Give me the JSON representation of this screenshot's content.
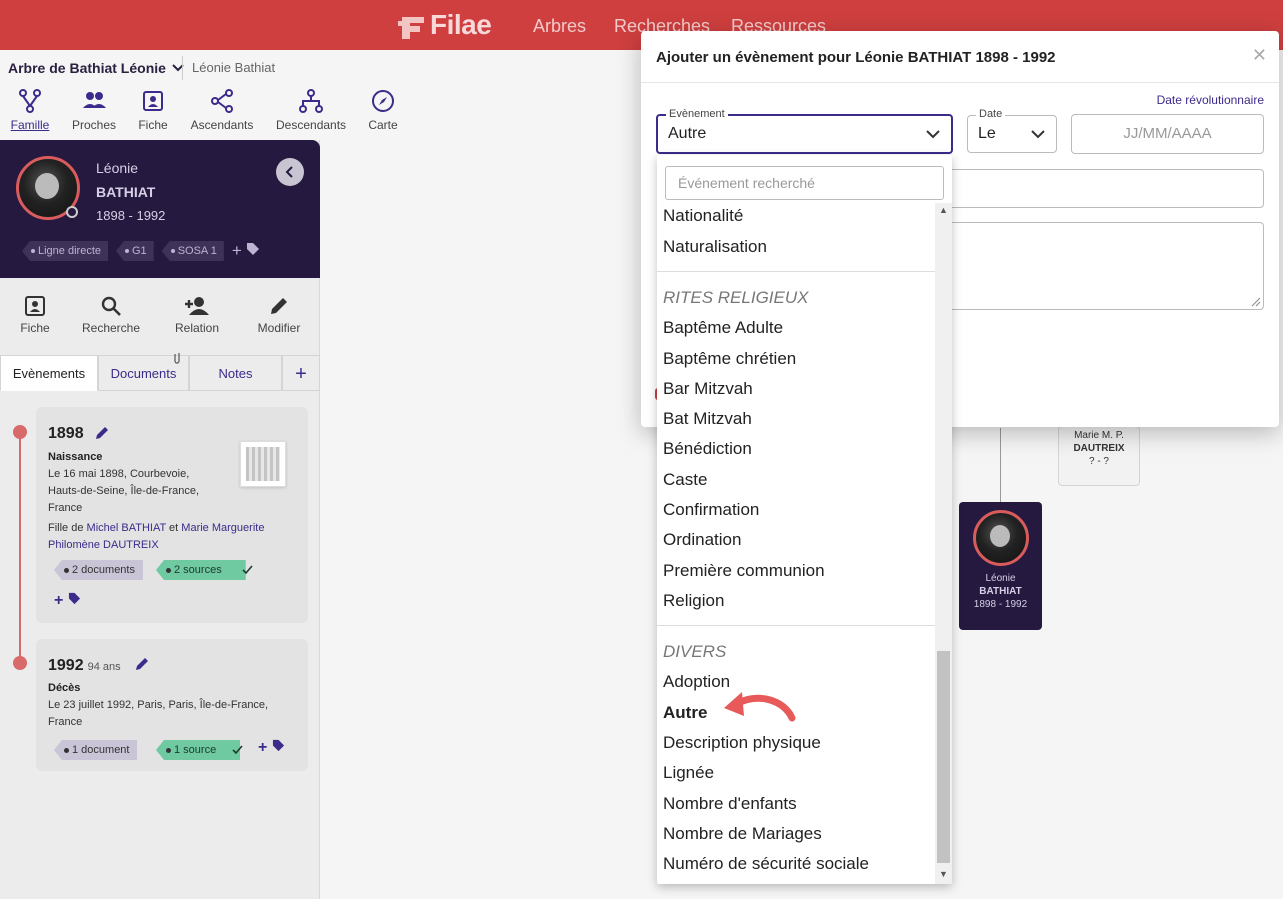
{
  "brand": {
    "name": "Filae",
    "color": "#cf3f3f",
    "accent": "#3d2a8a",
    "panel_dark": "#25193f"
  },
  "topnav": [
    "Arbres",
    "Recherches",
    "Ressources"
  ],
  "treebar": {
    "tree_name": "Arbre de Bathiat Léonie",
    "person": "Léonie Bathiat"
  },
  "viewtabs": [
    {
      "label": "Famille",
      "icon": "family-tree-icon",
      "active": true
    },
    {
      "label": "Proches",
      "icon": "people-icon"
    },
    {
      "label": "Fiche",
      "icon": "id-card-icon"
    },
    {
      "label": "Ascendants",
      "icon": "ascendants-icon"
    },
    {
      "label": "Descendants",
      "icon": "descendants-icon"
    },
    {
      "label": "Carte",
      "icon": "compass-icon"
    }
  ],
  "profile": {
    "first_name": "Léonie",
    "last_name": "BATHIAT",
    "dates": "1898 - 1992",
    "tags": [
      "Ligne directe",
      "G1",
      "SOSA 1"
    ]
  },
  "actions": [
    "Fiche",
    "Recherche",
    "Relation",
    "Modifier"
  ],
  "side_tabs": [
    "Evènements",
    "Documents",
    "Notes"
  ],
  "events": [
    {
      "year": "1898",
      "age": "",
      "type": "Naissance",
      "desc": "Le 16 mai 1898, Courbevoie, Hauts-de-Seine, Île-de-France, France",
      "filiation_prefix": "Fille de ",
      "father": "Michel BATHIAT",
      "and": " et ",
      "mother": "Marie Marguerite Philomène DAUTREIX",
      "documents": "2 documents",
      "sources": "2 sources"
    },
    {
      "year": "1992",
      "age": "94 ans",
      "type": "Décès",
      "desc": "Le 23 juillet 1992, Paris, Paris, Île-de-France, France",
      "documents": "1 document",
      "sources": "1 source"
    }
  ],
  "tree_cards": {
    "mother": {
      "name": "Marie M. P.",
      "last": "DAUTREIX",
      "dates": "? - ?"
    },
    "self": {
      "first": "Léonie",
      "last": "BATHIAT",
      "dates": "1898 - 1992"
    }
  },
  "modal": {
    "title": "Ajouter un évènement pour Léonie BATHIAT 1898 - 1992",
    "rev_link": "Date révolutionnaire",
    "event_label": "Evènement",
    "event_value": "Autre",
    "date_label": "Date",
    "date_value": "Le",
    "date_placeholder": "JJ/MM/AAAA"
  },
  "dropdown": {
    "search_placeholder": "Événement recherché",
    "group1_items": [
      "Nationalité",
      "Naturalisation"
    ],
    "group2_label": "RITES RELIGIEUX",
    "group2_items": [
      "Baptême Adulte",
      "Baptême chrétien",
      "Bar Mitzvah",
      "Bat Mitzvah",
      "Bénédiction",
      "Caste",
      "Confirmation",
      "Ordination",
      "Première communion",
      "Religion"
    ],
    "group3_label": "DIVERS",
    "group3_items": [
      "Adoption",
      "Autre",
      "Description physique",
      "Lignée",
      "Nombre d'enfants",
      "Nombre de Mariages",
      "Numéro de sécurité sociale"
    ],
    "selected": "Autre"
  }
}
